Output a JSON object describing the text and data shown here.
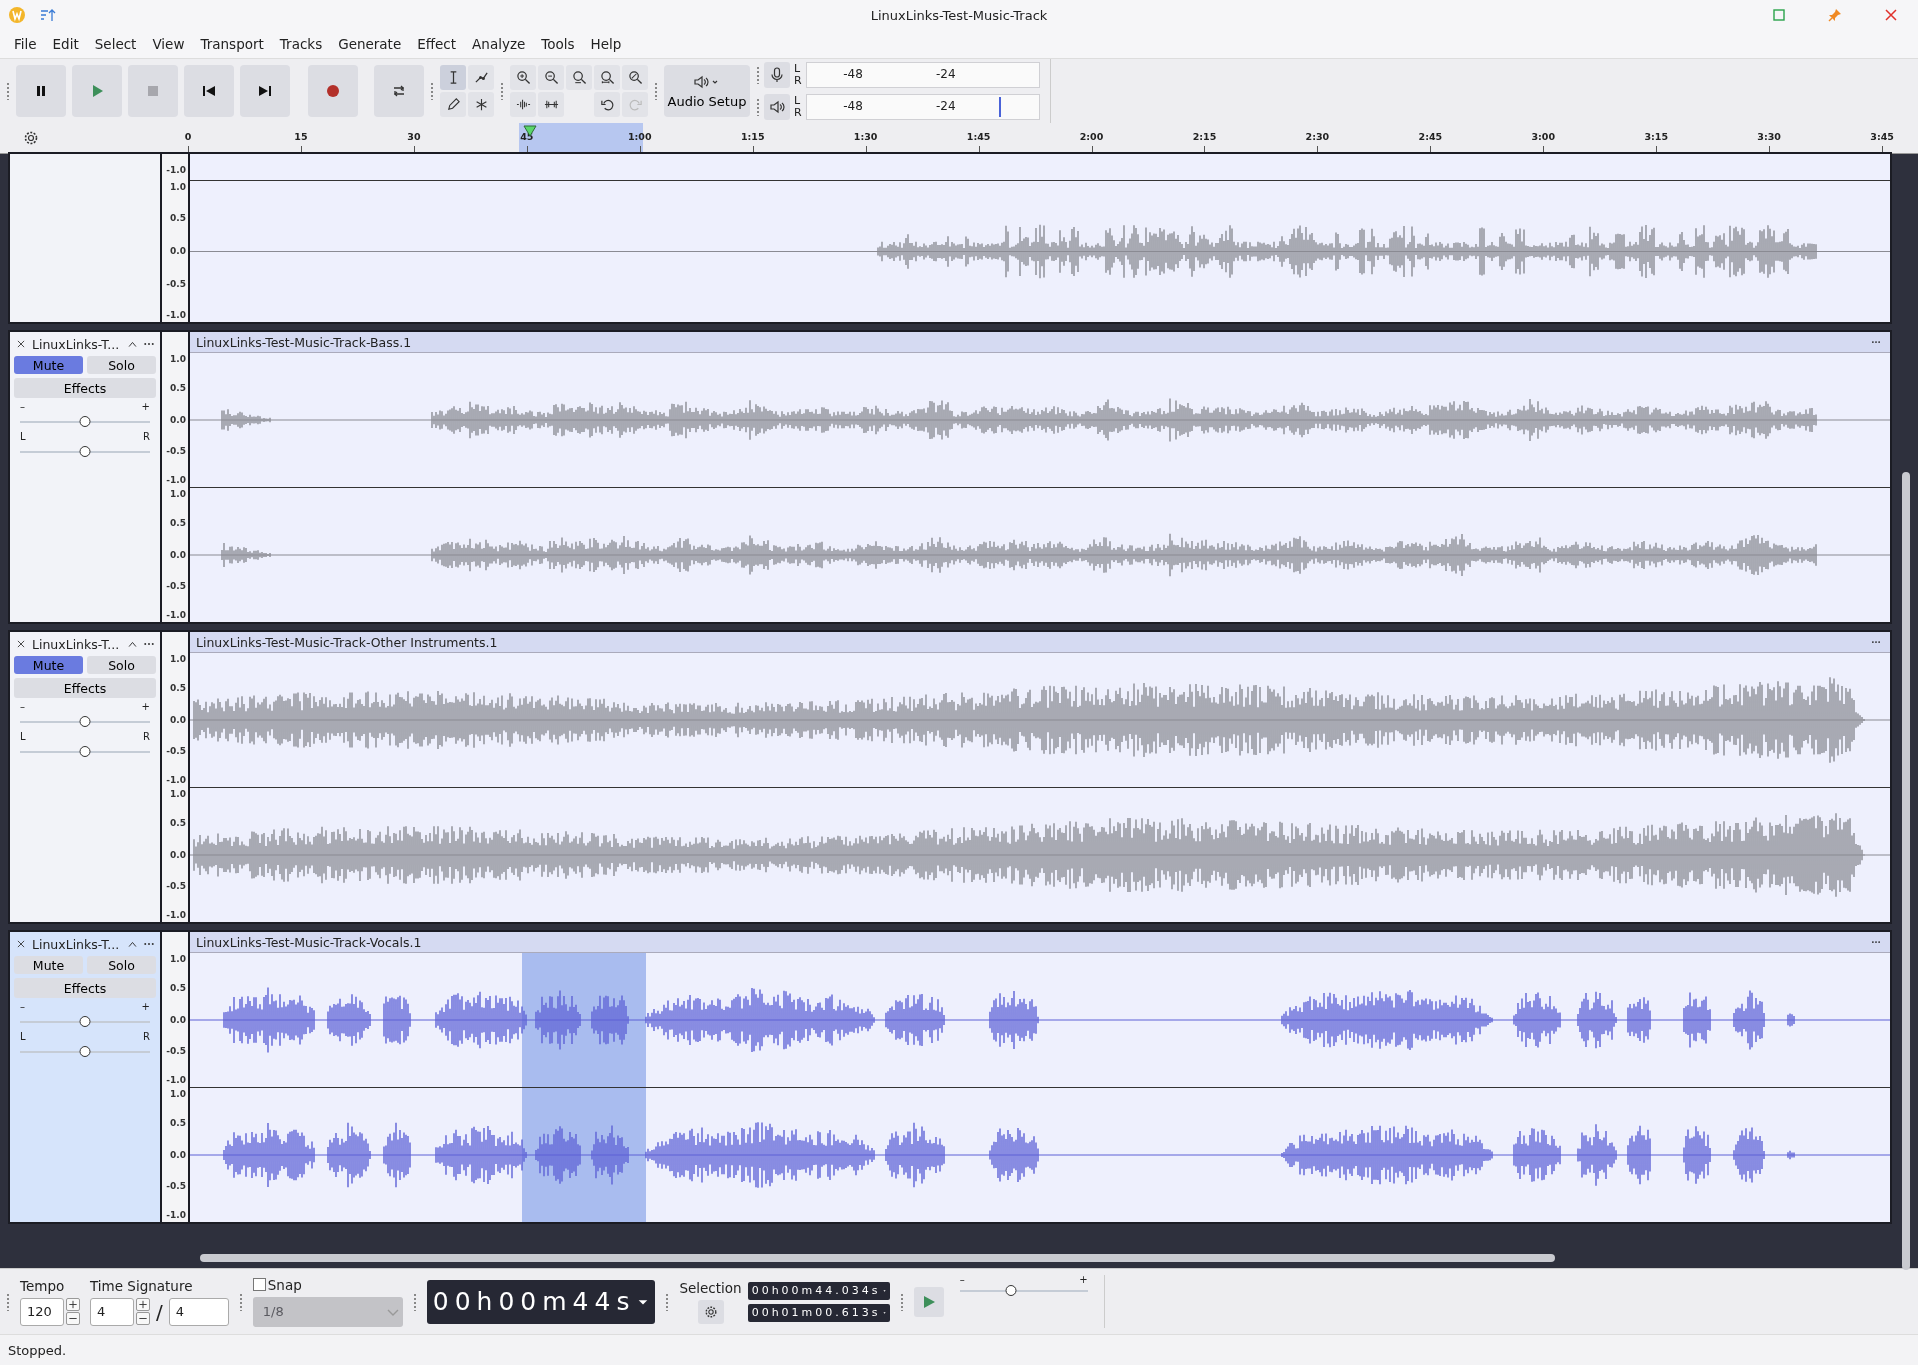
{
  "window": {
    "title": "LinuxLinks-Test-Music-Track"
  },
  "menu": [
    {
      "label": "File"
    },
    {
      "label": "Edit"
    },
    {
      "label": "Select"
    },
    {
      "label": "View"
    },
    {
      "label": "Transport"
    },
    {
      "label": "Tracks"
    },
    {
      "label": "Generate"
    },
    {
      "label": "Effect"
    },
    {
      "label": "Analyze"
    },
    {
      "label": "Tools"
    },
    {
      "label": "Help"
    }
  ],
  "audio_setup": {
    "label": "Audio Setup"
  },
  "meters": [
    {
      "kind": "record",
      "channels": [
        "L",
        "R"
      ],
      "ticks": [
        "-48",
        "-24"
      ]
    },
    {
      "kind": "playback",
      "channels": [
        "L",
        "R"
      ],
      "ticks": [
        "-48",
        "-24"
      ],
      "level": 0.83
    }
  ],
  "ruler": {
    "ticks": [
      "0",
      "15",
      "30",
      "45",
      "1:00",
      "1:15",
      "1:30",
      "1:45",
      "2:00",
      "2:15",
      "2:30",
      "2:45",
      "3:00",
      "3:15",
      "3:30",
      "3:45"
    ]
  },
  "tracks": [
    {
      "kind": "partial",
      "selected": false,
      "channels": [
        {
          "axis": [
            "-1.0"
          ]
        },
        {
          "axis": [
            "1.0",
            "0.5",
            "0.0",
            "-0.5",
            "-1.0"
          ]
        }
      ]
    },
    {
      "kind": "full",
      "name": "LinuxLinks-T...",
      "clip": "LinuxLinks-Test-Music-Track-Bass.1",
      "mute": "Mute",
      "solo": "Solo",
      "effects": "Effects",
      "muted": true,
      "soloed": false,
      "selected": false,
      "gain": {
        "min": "–",
        "max": "+",
        "level": 0.5
      },
      "pan": {
        "min": "L",
        "max": "R",
        "level": 0.5
      },
      "channels": [
        {
          "axis": [
            "1.0",
            "0.5",
            "0.0",
            "-0.5",
            "-1.0"
          ]
        },
        {
          "axis": [
            "1.0",
            "0.5",
            "0.0",
            "-0.5",
            "-1.0"
          ]
        }
      ]
    },
    {
      "kind": "full",
      "name": "LinuxLinks-T...",
      "clip": "LinuxLinks-Test-Music-Track-Other Instruments.1",
      "mute": "Mute",
      "solo": "Solo",
      "effects": "Effects",
      "muted": true,
      "soloed": false,
      "selected": false,
      "gain": {
        "min": "–",
        "max": "+",
        "level": 0.5
      },
      "pan": {
        "min": "L",
        "max": "R",
        "level": 0.5
      },
      "channels": [
        {
          "axis": [
            "1.0",
            "0.5",
            "0.0",
            "-0.5",
            "-1.0"
          ]
        },
        {
          "axis": [
            "1.0",
            "0.5",
            "0.0",
            "-0.5",
            "-1.0"
          ]
        }
      ]
    },
    {
      "kind": "full",
      "name": "LinuxLinks-T...",
      "clip": "LinuxLinks-Test-Music-Track-Vocals.1",
      "mute": "Mute",
      "solo": "Solo",
      "effects": "Effects",
      "muted": false,
      "soloed": false,
      "selected": true,
      "gain": {
        "min": "–",
        "max": "+",
        "level": 0.5
      },
      "pan": {
        "min": "L",
        "max": "R",
        "level": 0.5
      },
      "channels": [
        {
          "axis": [
            "1.0",
            "0.5",
            "0.0",
            "-0.5",
            "-1.0"
          ]
        },
        {
          "axis": [
            "1.0",
            "0.5",
            "0.0",
            "-0.5",
            "-1.0"
          ]
        }
      ]
    }
  ],
  "bottom": {
    "tempo_label": "Tempo",
    "tempo": "120",
    "time_signature_label": "Time Signature",
    "beats": "4",
    "separator": "/",
    "unit": "4",
    "snap": {
      "label": "Snap",
      "checked": false
    },
    "snap_value": {
      "value": "1/8",
      "disabled": true
    },
    "time": "00h00m44s",
    "selection_label": "Selection",
    "selection_start": "00h00m44.034s",
    "selection_end": "00h01m00.613s",
    "speed": {
      "min": "–",
      "max": "+",
      "level": 0.4
    }
  },
  "status_bar": {
    "text": "Stopped."
  }
}
